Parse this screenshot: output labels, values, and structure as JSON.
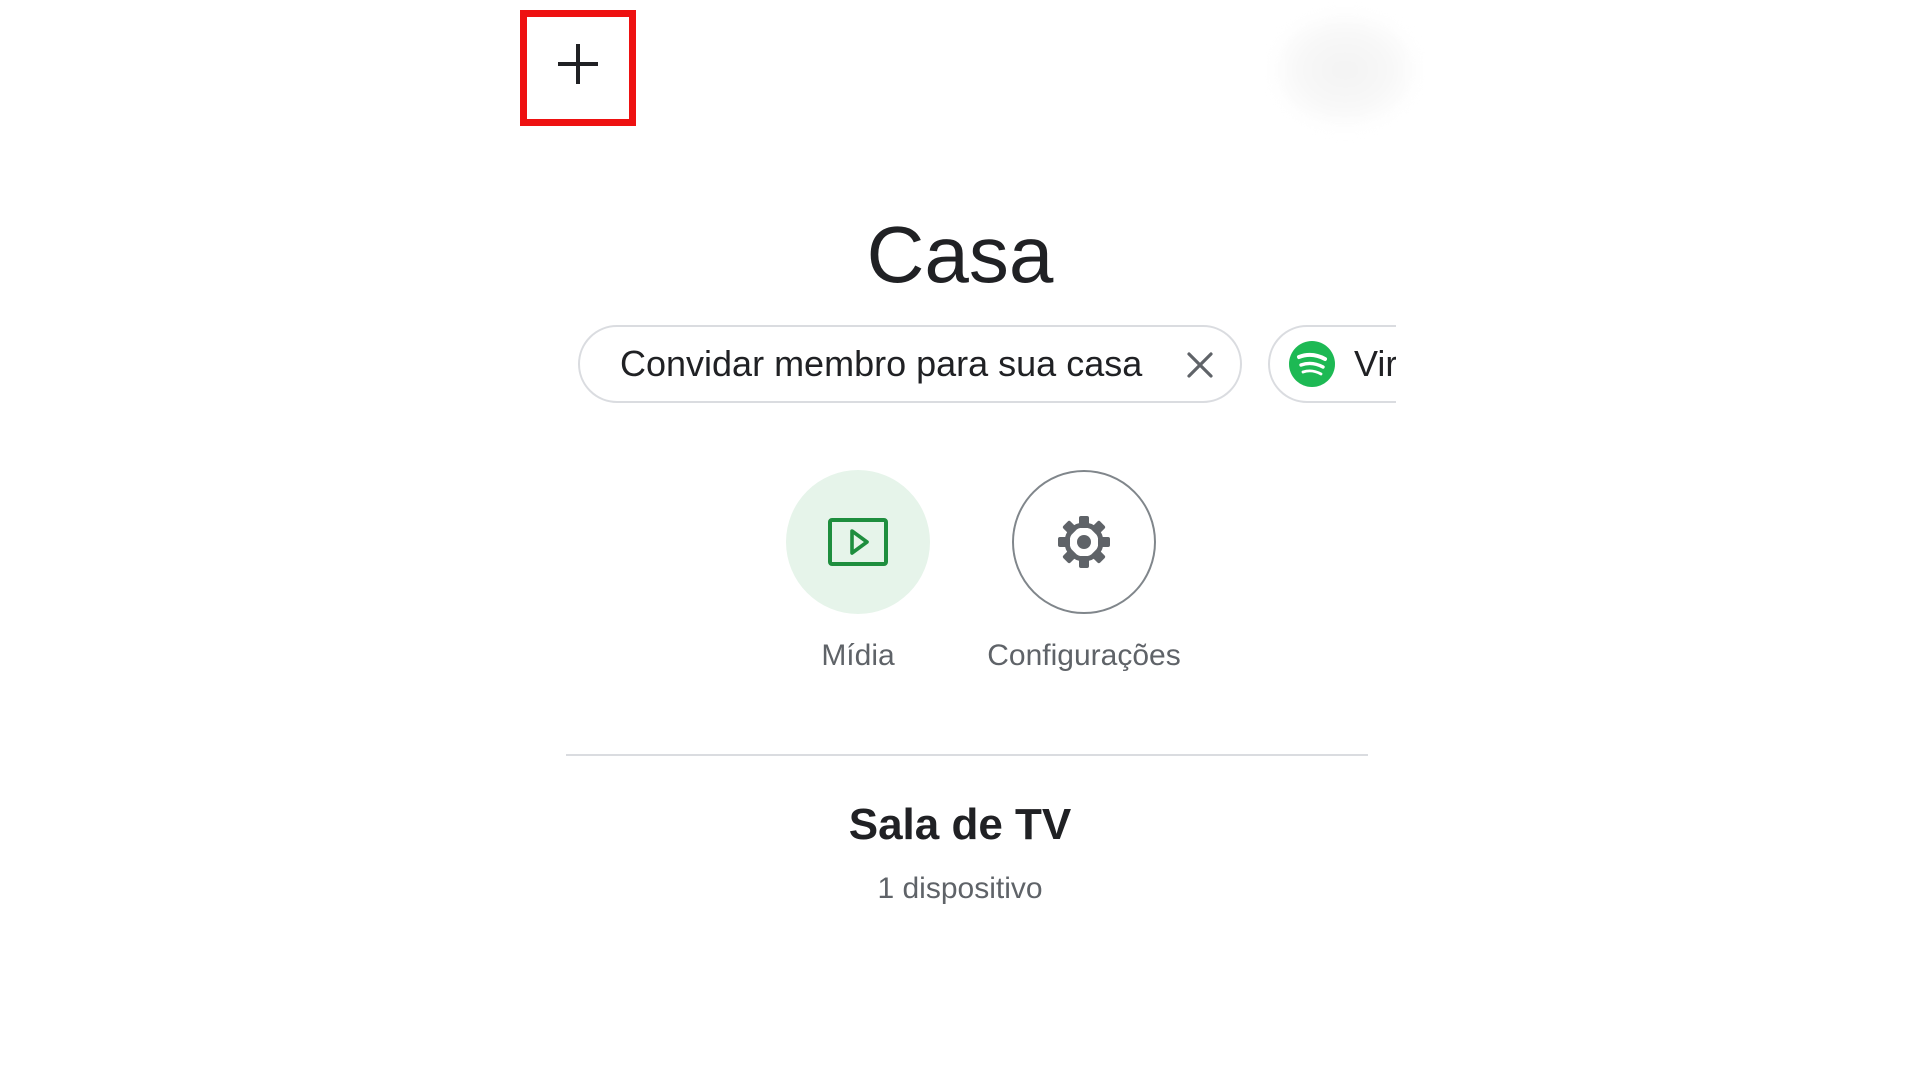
{
  "header": {
    "add_icon": "plus-icon",
    "highlight_color": "#ee1111",
    "title": "Casa"
  },
  "chips": {
    "invite_label": "Convidar membro para sua casa",
    "invite_close_icon": "close-icon",
    "spotify_label": "Vir",
    "spotify_icon": "spotify-icon",
    "spotify_color": "#1db954"
  },
  "actions": {
    "media": {
      "label": "Mídia",
      "icon": "play-icon",
      "color": "#1e8e3e"
    },
    "settings": {
      "label": "Configurações",
      "icon": "gear-icon"
    }
  },
  "room": {
    "name": "Sala de TV",
    "device_count": "1 dispositivo"
  }
}
